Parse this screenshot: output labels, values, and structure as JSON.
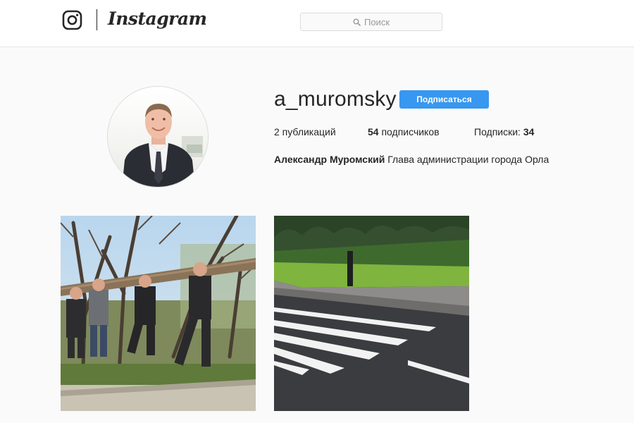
{
  "header": {
    "logo_icon": "instagram-camera-icon",
    "wordmark": "Instagram",
    "search": {
      "icon": "search-icon",
      "placeholder": "Поиск"
    }
  },
  "profile": {
    "username": "a_muromsky",
    "follow_label": "Подписаться",
    "stats": {
      "posts_count": "2",
      "posts_label": " публикаций",
      "followers_count": "54",
      "followers_label": " подписчиков",
      "following_label": "Подписки: ",
      "following_count": "34"
    },
    "bio": {
      "name": "Александр Муромский",
      "text": " Глава администрации города Орла"
    }
  },
  "posts": [
    {
      "subject": "men carrying a log"
    },
    {
      "subject": "pedestrian crosswalk"
    }
  ],
  "colors": {
    "accent": "#3897f0",
    "background": "#fafafa",
    "text": "#262626"
  }
}
